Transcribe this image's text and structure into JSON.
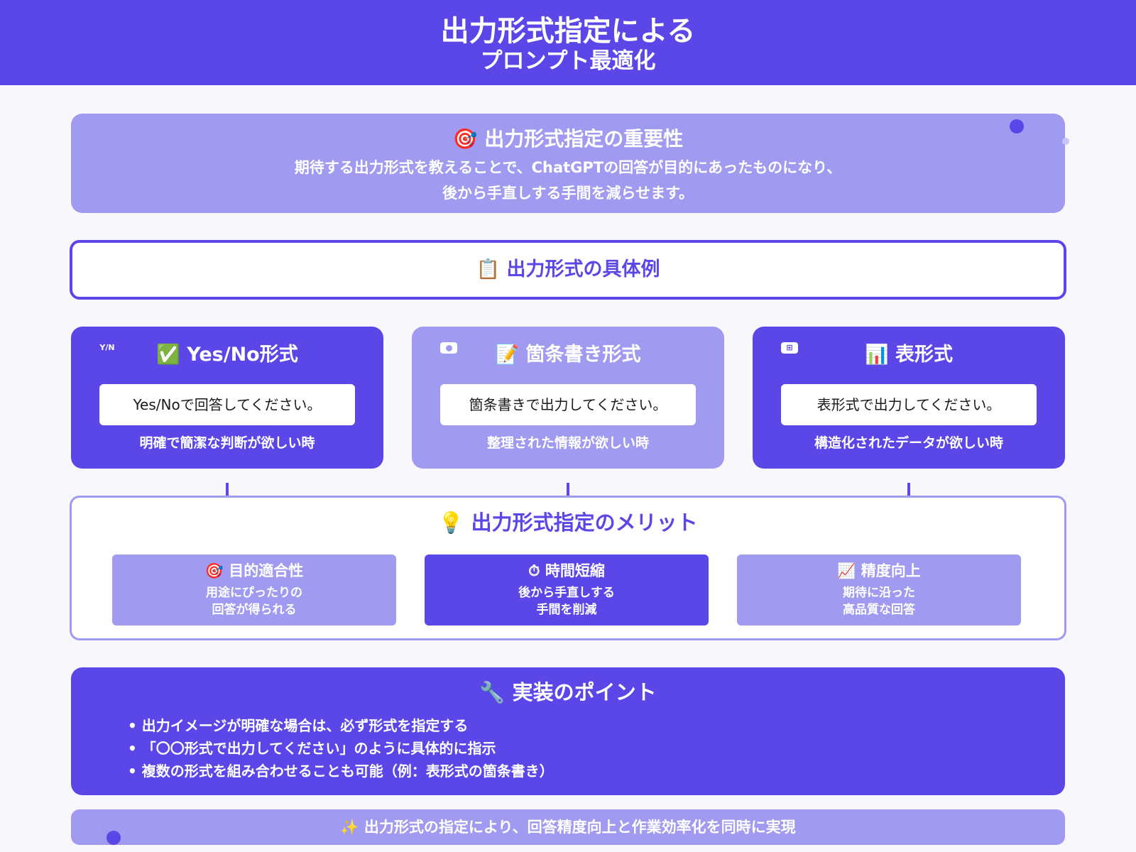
{
  "header": {
    "title_line1": "出力形式指定による",
    "title_line2": "プロンプト最適化"
  },
  "importance": {
    "title": "🎯 出力形式指定の重要性",
    "desc_line1": "期待する出力形式を教えることで、ChatGPTの回答が目的にあったものになり、",
    "desc_line2": "後から手直しする手間を減らせます。"
  },
  "examples": {
    "heading": "📋 出力形式の具体例",
    "cards": [
      {
        "badge": "Y/N",
        "title": "✅ Yes/No形式",
        "example": "Yes/Noで回答してください。",
        "use": "明確で簡潔な判断が欲しい時"
      },
      {
        "badge": "",
        "title": "📝 箇条書き形式",
        "example": "箇条書きで出力してください。",
        "use": "整理された情報が欲しい時"
      },
      {
        "badge": "⊞",
        "title": "📊 表形式",
        "example": "表形式で出力してください。",
        "use": "構造化されたデータが欲しい時"
      }
    ]
  },
  "merits": {
    "heading": "💡 出力形式指定のメリット",
    "cards": [
      {
        "title": "🎯 目的適合性",
        "desc_line1": "用途にぴったりの",
        "desc_line2": "回答が得られる"
      },
      {
        "title": "⏱ 時間短縮",
        "desc_line1": "後から手直しする",
        "desc_line2": "手間を削減"
      },
      {
        "title": "📈 精度向上",
        "desc_line1": "期待に沿った",
        "desc_line2": "高品質な回答"
      }
    ]
  },
  "implementation": {
    "heading": "🔧 実装のポイント",
    "points": [
      "出力イメージが明確な場合は、必ず形式を指定する",
      "「〇〇形式で出力してください」のように具体的に指示",
      "複数の形式を組み合わせることも可能（例：表形式の箇条書き）"
    ]
  },
  "footer": {
    "text": "✨ 出力形式の指定により、回答精度向上と作業効率化を同時に実現"
  },
  "colors": {
    "primary": "#5b46e8",
    "light": "#a09af0",
    "background": "#f8f8fc"
  }
}
